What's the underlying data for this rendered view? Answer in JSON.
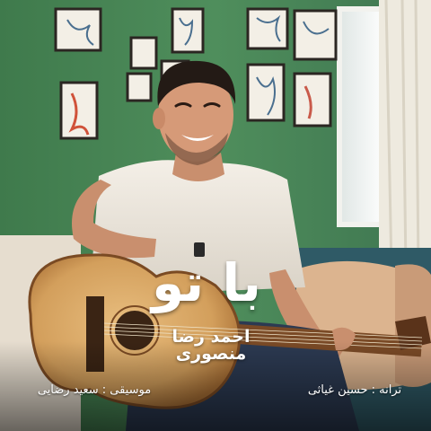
{
  "cover": {
    "title": "با تو",
    "artist": "احمد رضا منصوری",
    "music_credit": "موسیقی : سعید رضایی",
    "lyrics_credit": "ترانه : حسین غیاثی"
  },
  "colors": {
    "wall": "#4d8a5a",
    "frame": "#2b2622",
    "guitar_body": "#d8a868",
    "shirt": "#efe9e0"
  }
}
